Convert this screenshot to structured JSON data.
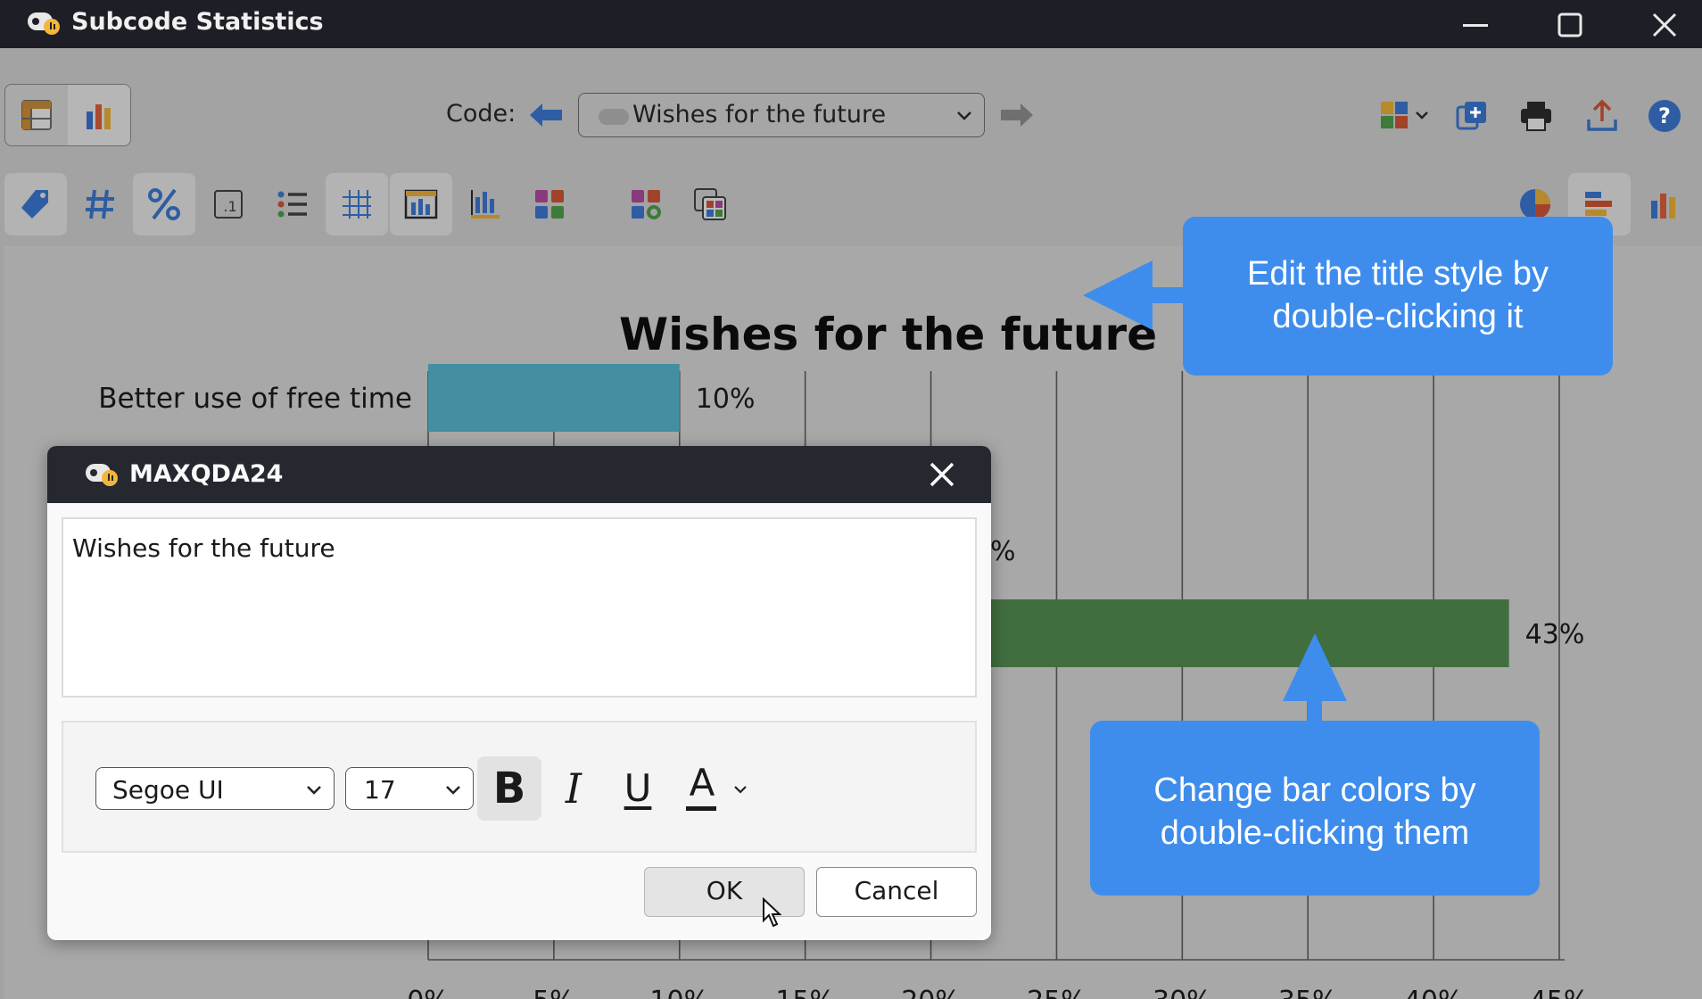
{
  "window": {
    "title": "Subcode Statistics"
  },
  "toolbar": {
    "code_label": "Code:",
    "code_value": "Wishes for the future"
  },
  "chart_data": {
    "type": "bar",
    "orientation": "horizontal",
    "title": "Wishes for the future",
    "categories": [
      "Better use of free time",
      "",
      ""
    ],
    "values": [
      10,
      null,
      43
    ],
    "value_labels": [
      "10%",
      "%",
      "43%"
    ],
    "xticks": [
      "0%",
      "5%",
      "10%",
      "15%",
      "20%",
      "25%",
      "30%",
      "35%",
      "40%",
      "45%"
    ],
    "xlim": [
      0,
      45
    ],
    "grid": true,
    "colors": [
      "#438ea0",
      "#7d7d7d",
      "#416e3f"
    ]
  },
  "callouts": {
    "title_tip_line1": "Edit the title style by",
    "title_tip_line2": "double-clicking it",
    "bar_tip_line1": "Change bar colors by",
    "bar_tip_line2": "double-clicking them"
  },
  "dialog": {
    "title": "MAXQDA24",
    "text_value": "Wishes for the future",
    "font_family": "Segoe UI",
    "font_size": "17",
    "bold_glyph": "B",
    "italic_glyph": "I",
    "underline_glyph": "U",
    "color_glyph": "A",
    "ok_label": "OK",
    "cancel_label": "Cancel"
  },
  "colors": {
    "accent": "#3e8ded",
    "titlebar": "#1e1e26",
    "dialog_header": "#262830"
  },
  "icons": {
    "app": "maxqda-logo-icon",
    "minimize": "minimize-icon",
    "maximize": "maximize-icon",
    "close": "close-icon"
  }
}
